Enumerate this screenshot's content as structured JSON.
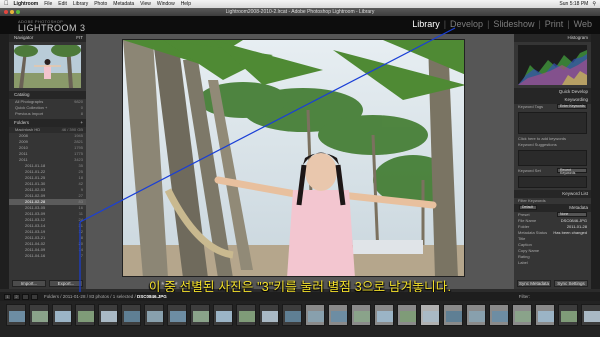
{
  "menubar": {
    "app_name": "Lightroom",
    "menus": [
      "File",
      "Edit",
      "Library",
      "Photo",
      "Metadata",
      "View",
      "Window",
      "Help"
    ],
    "clock": "Sun 5:18 PM"
  },
  "window": {
    "title": "Lightroom2008-2010-2.lrcat - Adobe Photoshop Lightroom - Library"
  },
  "identity": {
    "brand_small": "ADOBE PHOTOSHOP",
    "brand_big": "LIGHTROOM 3"
  },
  "modules": [
    {
      "label": "Library",
      "active": true
    },
    {
      "label": "Develop",
      "active": false
    },
    {
      "label": "Slideshow",
      "active": false
    },
    {
      "label": "Print",
      "active": false
    },
    {
      "label": "Web",
      "active": false
    }
  ],
  "left_panel": {
    "navigator": {
      "title": "Navigator",
      "zoom": "FIT"
    },
    "catalog": {
      "title": "Catalog",
      "items": [
        {
          "label": "All Photographs",
          "count": "9820"
        },
        {
          "label": "Quick Collection +",
          "count": "0"
        },
        {
          "label": "Previous Import",
          "count": "8"
        }
      ]
    },
    "folders": {
      "title": "Folders",
      "volume": {
        "label": "Macintosh HD",
        "info": "46 / 390 GB"
      },
      "items": [
        {
          "label": "2008",
          "count": "1945"
        },
        {
          "label": "2009",
          "count": "2821"
        },
        {
          "label": "2010",
          "count": "1795"
        },
        {
          "label": "2011",
          "count": "1775"
        },
        {
          "label": "2011",
          "count": "3423"
        },
        {
          "label": "2011-01-18",
          "count": "35"
        },
        {
          "label": "2011-01-22",
          "count": "25"
        },
        {
          "label": "2011-01-25",
          "count": "18"
        },
        {
          "label": "2011-01-30",
          "count": "42"
        },
        {
          "label": "2011-02-03",
          "count": "9"
        },
        {
          "label": "2011-02-09",
          "count": "27"
        },
        {
          "label": "2011-02-28",
          "count": "83",
          "selected": true
        },
        {
          "label": "2011-03-05",
          "count": "16"
        },
        {
          "label": "2011-03-09",
          "count": "11"
        },
        {
          "label": "2011-03-12",
          "count": "24"
        },
        {
          "label": "2011-03-14",
          "count": "31"
        },
        {
          "label": "2011-03-19",
          "count": "12"
        },
        {
          "label": "2011-03-21",
          "count": "8"
        },
        {
          "label": "2011-04-02",
          "count": "20"
        },
        {
          "label": "2011-04-09",
          "count": "14"
        },
        {
          "label": "2011-04-16",
          "count": "7"
        }
      ]
    },
    "import_label": "Import...",
    "export_label": "Export..."
  },
  "right_panel": {
    "histogram_title": "Histogram",
    "quick_develop": "Quick Develop",
    "keywording": {
      "title": "Keywording",
      "keyword_tags_label": "Keyword Tags",
      "keyword_tags_value": "Enter Keywords",
      "click_hint": "Click here to add keywords",
      "suggestions": "Keyword Suggestions",
      "keyword_set_label": "Keyword Set",
      "keyword_set_value": "Recent Keywords"
    },
    "keyword_list": "Keyword List",
    "keyword_filter": "Filter Keywords",
    "metadata": {
      "title": "Metadata",
      "preset_label": "Preset",
      "preset_value": "None",
      "default_label": "Default",
      "fields": [
        {
          "label": "File Name",
          "value": "DSC0846.JPG"
        },
        {
          "label": "Folder",
          "value": "2011-01-28"
        },
        {
          "label": "Metadata Status",
          "value": "Has been changed"
        },
        {
          "label": "Title",
          "value": ""
        },
        {
          "label": "Caption",
          "value": ""
        },
        {
          "label": "Copy Name",
          "value": ""
        },
        {
          "label": "Rating",
          "value": ""
        },
        {
          "label": "Label",
          "value": ""
        }
      ]
    },
    "sync_label": "Sync Settings",
    "sync_meta": "Sync Metadata"
  },
  "main": {
    "photo_alt": "Girl with arms outstretched among palm trees",
    "rating_stars": "★★★★★"
  },
  "subtitle": "이 중 선별된 사진은 \"3\"키를 눌러 별점 3으로 남겨놓니다.",
  "filmstrip": {
    "page1": "1",
    "page2": "2",
    "breadcrumb_prefix": "Folders / 2011-01-28 / 83 photos / 1 selected /",
    "file": "DSC0846.JPG",
    "filter_label": "Filter:",
    "thumb_count": 26,
    "active_index": 18
  },
  "colors": {
    "accent_line": "#1a3fd6",
    "subtitle": "#f3e02a",
    "panel": "#353535"
  }
}
